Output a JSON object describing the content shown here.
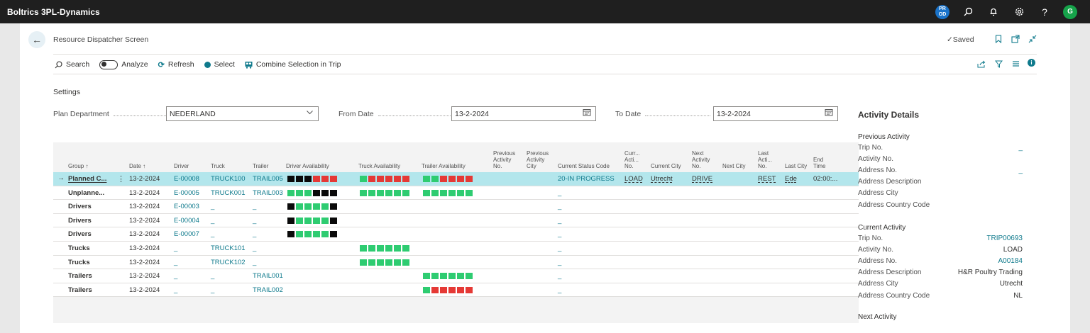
{
  "app": {
    "title": "Boltrics 3PL-Dynamics",
    "env_badge": "PR OD",
    "avatar_initial": "G",
    "icons": [
      "search-icon",
      "bell-icon",
      "gear-icon",
      "help-icon"
    ]
  },
  "page": {
    "title": "Resource Dispatcher Screen",
    "saved": "✓Saved"
  },
  "actions": {
    "search": "Search",
    "analyze": "Analyze",
    "refresh": "Refresh",
    "select": "Select",
    "combine": "Combine Selection in Trip"
  },
  "settings": {
    "title": "Settings",
    "plan_department_label": "Plan Department",
    "plan_department_value": "NEDERLAND",
    "from_date_label": "From Date",
    "from_date_value": "13-2-2024",
    "to_date_label": "To Date",
    "to_date_value": "13-2-2024"
  },
  "grid": {
    "headers": {
      "group": "Group ↑",
      "date": "Date ↑",
      "driver": "Driver",
      "truck": "Truck",
      "trailer": "Trailer",
      "driver_avail": "Driver Availability",
      "truck_avail": "Truck Availability",
      "trailer_avail": "Trailer Availability",
      "prev_activity_no": "Previous\nActivity\nNo.",
      "prev_activity_city": "Previous\nActivity\nCity",
      "status": "Current Status Code",
      "curr_activity_no": "Curr...\nActi...\nNo.",
      "current_city": "Current City",
      "next_activity_no": "Next\nActivity\nNo.",
      "next_city": "Next City",
      "last_activity_no": "Last\nActi...\nNo.",
      "last_city": "Last City",
      "end_time": "End\nTime"
    },
    "rows": [
      {
        "group": "Planned C...",
        "date": "13-2-2024",
        "driver": "E-00008",
        "truck": "TRUCK100",
        "trailer": "TRAIL005",
        "driver_av": "kkkrrr",
        "truck_av": "grrrrr",
        "trailer_av": "ggrrrr",
        "status": "20-IN PROGRESS",
        "curr": "LOAD",
        "city": "Utrecht",
        "next": "DRIVE",
        "last": "REST",
        "last_city": "Ede",
        "end": "02:00:..."
      },
      {
        "group": "Unplanne...",
        "date": "13-2-2024",
        "driver": "E-00005",
        "truck": "TRUCK001",
        "trailer": "TRAIL003",
        "driver_av": "gggkkk",
        "truck_av": "gggggg",
        "trailer_av": "gggggg",
        "status": "_",
        "curr": "",
        "city": "",
        "next": "",
        "last": "",
        "last_city": "",
        "end": ""
      },
      {
        "group": "Drivers",
        "date": "13-2-2024",
        "driver": "E-00003",
        "truck": "_",
        "trailer": "_",
        "driver_av": "kggggk",
        "truck_av": "",
        "trailer_av": "",
        "status": "_",
        "curr": "",
        "city": "",
        "next": "",
        "last": "",
        "last_city": "",
        "end": ""
      },
      {
        "group": "Drivers",
        "date": "13-2-2024",
        "driver": "E-00004",
        "truck": "_",
        "trailer": "_",
        "driver_av": "kggggk",
        "truck_av": "",
        "trailer_av": "",
        "status": "_",
        "curr": "",
        "city": "",
        "next": "",
        "last": "",
        "last_city": "",
        "end": ""
      },
      {
        "group": "Drivers",
        "date": "13-2-2024",
        "driver": "E-00007",
        "truck": "_",
        "trailer": "_",
        "driver_av": "kggggk",
        "truck_av": "",
        "trailer_av": "",
        "status": "_",
        "curr": "",
        "city": "",
        "next": "",
        "last": "",
        "last_city": "",
        "end": ""
      },
      {
        "group": "Trucks",
        "date": "13-2-2024",
        "driver": "_",
        "truck": "TRUCK101",
        "trailer": "_",
        "driver_av": "",
        "truck_av": "gggggg",
        "trailer_av": "",
        "status": "_",
        "curr": "",
        "city": "",
        "next": "",
        "last": "",
        "last_city": "",
        "end": ""
      },
      {
        "group": "Trucks",
        "date": "13-2-2024",
        "driver": "_",
        "truck": "TRUCK102",
        "trailer": "_",
        "driver_av": "",
        "truck_av": "gggggg",
        "trailer_av": "",
        "status": "_",
        "curr": "",
        "city": "",
        "next": "",
        "last": "",
        "last_city": "",
        "end": ""
      },
      {
        "group": "Trailers",
        "date": "13-2-2024",
        "driver": "_",
        "truck": "_",
        "trailer": "TRAIL001",
        "driver_av": "",
        "truck_av": "",
        "trailer_av": "gggggg",
        "status": "_",
        "curr": "",
        "city": "",
        "next": "",
        "last": "",
        "last_city": "",
        "end": ""
      },
      {
        "group": "Trailers",
        "date": "13-2-2024",
        "driver": "_",
        "truck": "_",
        "trailer": "TRAIL002",
        "driver_av": "",
        "truck_av": "",
        "trailer_av": "grrrrr",
        "status": "_",
        "curr": "",
        "city": "",
        "next": "",
        "last": "",
        "last_city": "",
        "end": ""
      }
    ]
  },
  "colors": {
    "green": "#2ecc71",
    "red": "#e53935",
    "black": "#0a0a0a",
    "accent": "#0f7a8c",
    "selected_row": "#b3e6ec"
  },
  "factbox": {
    "title": "Activity Details",
    "previous": {
      "title": "Previous Activity",
      "rows": [
        {
          "k": "Trip No.",
          "v": "_"
        },
        {
          "k": "Activity No.",
          "v": ""
        },
        {
          "k": "Address No.",
          "v": "_"
        },
        {
          "k": "Address Description",
          "v": ""
        },
        {
          "k": "Address City",
          "v": ""
        },
        {
          "k": "Address Country Code",
          "v": ""
        }
      ]
    },
    "current": {
      "title": "Current Activity",
      "rows": [
        {
          "k": "Trip No.",
          "v": "TRIP00693"
        },
        {
          "k": "Activity No.",
          "v": "LOAD"
        },
        {
          "k": "Address No.",
          "v": "A00184"
        },
        {
          "k": "Address Description",
          "v": "H&R Poultry Trading"
        },
        {
          "k": "Address City",
          "v": "Utrecht"
        },
        {
          "k": "Address Country Code",
          "v": "NL"
        }
      ]
    },
    "next": {
      "title": "Next Activity"
    }
  }
}
